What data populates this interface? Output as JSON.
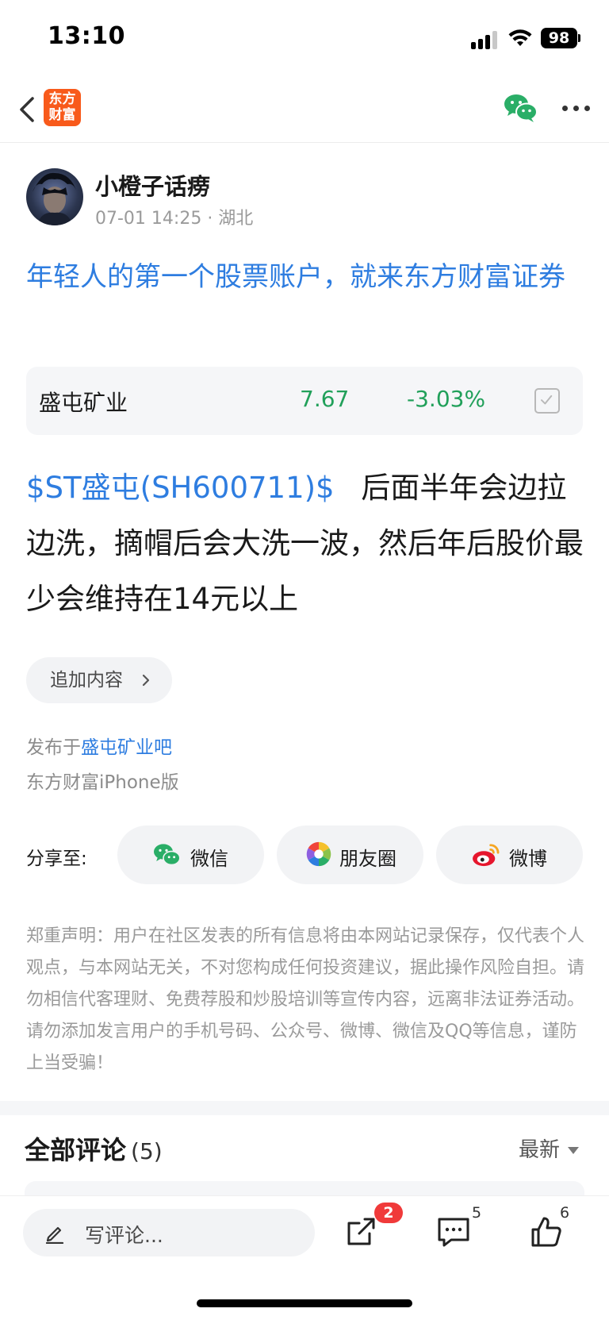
{
  "status_bar": {
    "time": "13:10",
    "battery": "98"
  },
  "nav": {
    "brand_logo_text": "东方财富"
  },
  "author": {
    "name": "小橙子话痨",
    "meta": "07-01 14:25 · 湖北"
  },
  "promo_text": "年轻人的第一个股票账户，就来东方财富证券",
  "stock_card": {
    "name": "盛屯矿业",
    "price": "7.67",
    "change": "-3.03%",
    "color": "#21a05a"
  },
  "post": {
    "stock_link": "$ST盛屯(SH600711)$",
    "text": "后面半年会边拉边洗，摘帽后会大洗一波，然后年后股价最少会维持在14元以上"
  },
  "append_button": "追加内容",
  "publish": {
    "prefix": "发布于",
    "forum": "盛屯矿业吧",
    "client": "东方财富iPhone版"
  },
  "share": {
    "label": "分享至:",
    "buttons": [
      {
        "label": "微信",
        "icon": "wechat-icon"
      },
      {
        "label": "朋友圈",
        "icon": "moments-icon"
      },
      {
        "label": "微博",
        "icon": "weibo-icon"
      }
    ]
  },
  "disclaimer": "郑重声明：用户在社区发表的所有信息将由本网站记录保存，仅代表个人观点，与本网站无关，不对您构成任何投资建议，据此操作风险自担。请勿相信代客理财、免费荐股和炒股培训等宣传内容，远离非法证券活动。请勿添加发言用户的手机号码、公众号、微博、微信及QQ等信息，谨防上当受骗！",
  "comments": {
    "title": "全部评论",
    "count": "(5)",
    "sort": "最新"
  },
  "bottom_bar": {
    "input_placeholder": "写评论...",
    "share_badge": "2",
    "comment_count": "5",
    "like_count": "6"
  },
  "colors": {
    "brand": "#f85a1b",
    "link": "#2e7de0",
    "down": "#21a05a",
    "badge": "#f03a3a"
  }
}
